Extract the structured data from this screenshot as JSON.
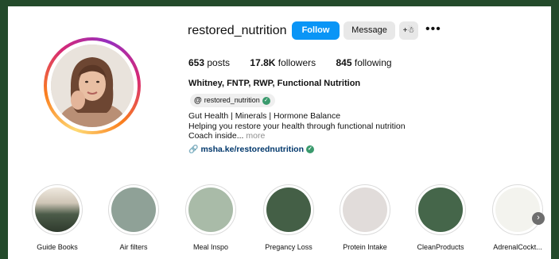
{
  "profile": {
    "username": "restored_nutrition",
    "follow_label": "Follow",
    "message_label": "Message",
    "adduser_label": "+Ȓ",
    "more_label": "•••"
  },
  "stats": {
    "posts_count": "653",
    "posts_label": "posts",
    "followers_count": "17.8K",
    "followers_label": "followers",
    "following_count": "845",
    "following_label": "following"
  },
  "bio": {
    "full_name": "Whitney, FNTP, RWP, Functional Nutrition",
    "threads_handle": "restored_nutrition",
    "line1": "Gut Health | Minerals | Hormone Balance",
    "line2": "Helping you restore your health through functional nutrition",
    "line3": "Coach inside...",
    "more": "more",
    "link": "msha.ke/restorednutrition"
  },
  "highlights": [
    {
      "label": "Guide Books",
      "color": "#5d6b58"
    },
    {
      "label": "Air filters",
      "color": "#8fa197"
    },
    {
      "label": "Meal Inspo",
      "color": "#a9bba8"
    },
    {
      "label": "Pregancy Loss",
      "color": "#445f46"
    },
    {
      "label": "Protein Intake",
      "color": "#e1dcda"
    },
    {
      "label": "CleanProducts",
      "color": "#45664a"
    },
    {
      "label": "AdrenalCockt...",
      "color": "#f3f3ee"
    }
  ],
  "colors": {
    "accent": "#0a95f6",
    "verified": "#3a9a6d",
    "background": "#234a2b"
  }
}
